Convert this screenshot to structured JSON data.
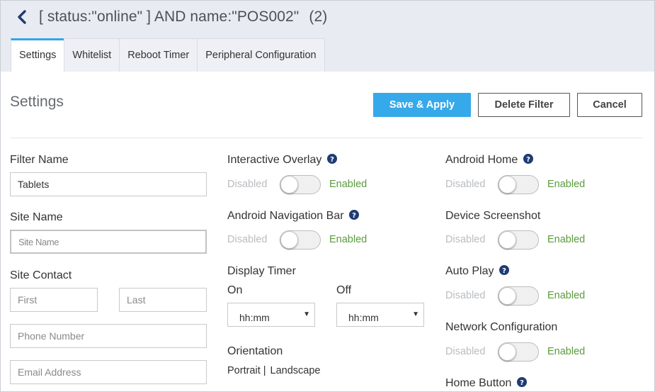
{
  "header": {
    "title": "[ status:\"online\" ] AND name:\"POS002\"",
    "count": "(2)"
  },
  "tabs": [
    {
      "label": "Settings"
    },
    {
      "label": "Whitelist"
    },
    {
      "label": "Reboot Timer"
    },
    {
      "label": "Peripheral Configuration"
    }
  ],
  "section": {
    "title": "Settings",
    "save_label": "Save & Apply",
    "delete_label": "Delete Filter",
    "cancel_label": "Cancel"
  },
  "left": {
    "filter_name_label": "Filter Name",
    "filter_name_value": "Tablets",
    "site_name_label": "Site Name",
    "site_name_placeholder": "Site Name",
    "site_contact_label": "Site Contact",
    "first_placeholder": "First",
    "last_placeholder": "Last",
    "phone_placeholder": "Phone Number",
    "email_placeholder": "Email Address"
  },
  "toggle_text": {
    "disabled": "Disabled",
    "enabled": "Enabled"
  },
  "middle": {
    "interactive_overlay": "Interactive Overlay",
    "android_nav_bar": "Android Navigation Bar",
    "display_timer": "Display Timer",
    "on_label": "On",
    "off_label": "Off",
    "on_value": "hh:mm",
    "off_value": "hh:mm",
    "orientation": "Orientation",
    "portrait": "Portrait",
    "separator": "|",
    "landscape": "Landscape"
  },
  "right": {
    "android_home": "Android Home",
    "device_screenshot": "Device Screenshot",
    "auto_play": "Auto Play",
    "network_configuration": "Network Configuration",
    "home_button": "Home Button"
  },
  "colors": {
    "accent": "#36a9ea",
    "enabled_text": "#5a9b3c",
    "disabled_text": "#b9bcc0",
    "header_bg": "#e8ebf2",
    "back_icon": "#1f3b73"
  },
  "icons": {
    "back": "chevron-left-icon",
    "help": "question-circle-icon",
    "select_caret": "caret-down-icon"
  }
}
